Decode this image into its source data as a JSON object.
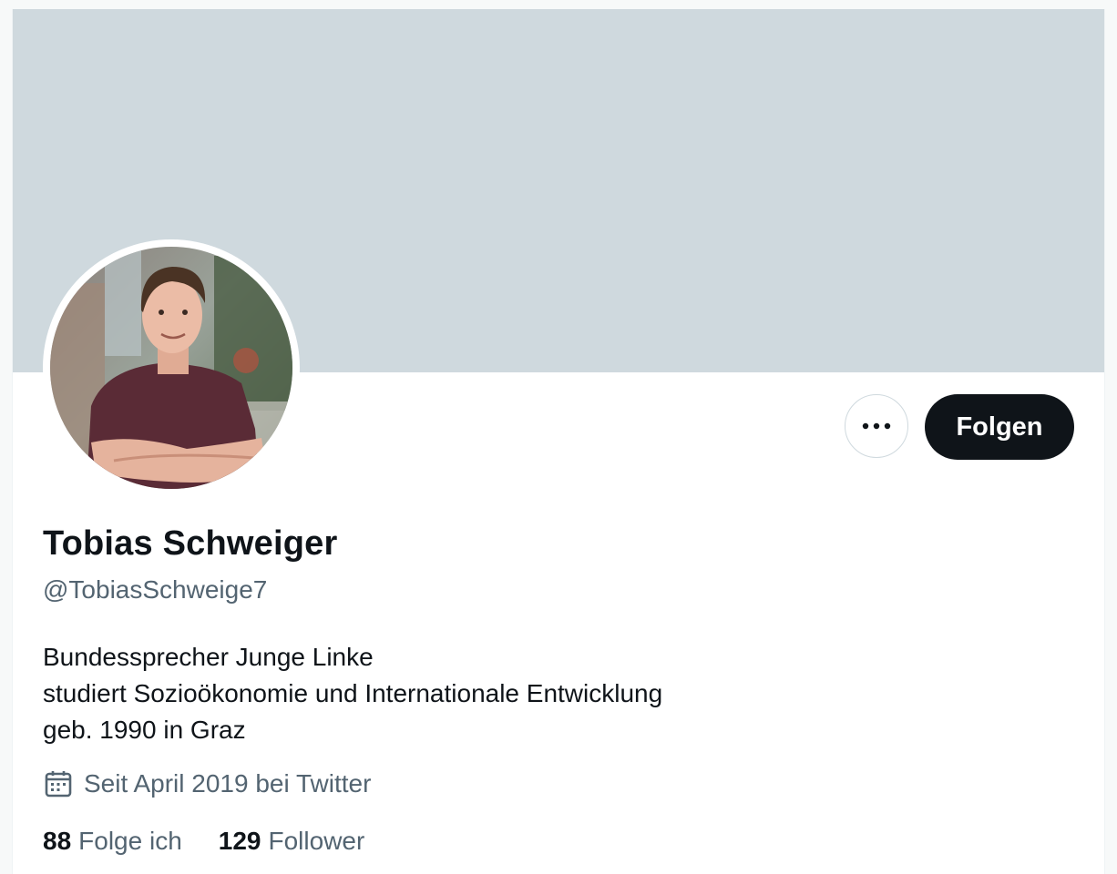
{
  "profile": {
    "display_name": "Tobias Schweiger",
    "handle": "@TobiasSchweige7",
    "bio": [
      "Bundessprecher Junge Linke",
      "studiert Sozioökonomie und Internationale Entwicklung",
      "geb. 1990 in Graz"
    ],
    "joined": "Seit April 2019 bei Twitter",
    "following": {
      "count": "88",
      "label": "Folge ich"
    },
    "followers": {
      "count": "129",
      "label": "Follower"
    }
  },
  "actions": {
    "follow_label": "Folgen",
    "more_icon": "more-horizontal-icon"
  },
  "icons": {
    "joined": "calendar-icon"
  },
  "colors": {
    "banner": "#cfd9de",
    "primary_text": "#0f1419",
    "secondary_text": "#536471",
    "follow_button_bg": "#0f1419"
  }
}
